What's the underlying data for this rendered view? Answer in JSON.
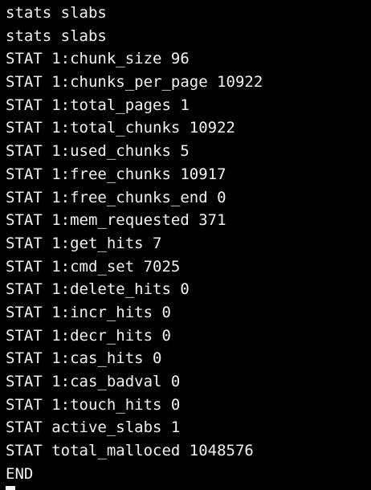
{
  "terminal": {
    "lines": [
      "stats slabs",
      "stats slabs",
      "STAT 1:chunk_size 96",
      "STAT 1:chunks_per_page 10922",
      "STAT 1:total_pages 1",
      "STAT 1:total_chunks 10922",
      "STAT 1:used_chunks 5",
      "STAT 1:free_chunks 10917",
      "STAT 1:free_chunks_end 0",
      "STAT 1:mem_requested 371",
      "STAT 1:get_hits 7",
      "STAT 1:cmd_set 7025",
      "STAT 1:delete_hits 0",
      "STAT 1:incr_hits 0",
      "STAT 1:decr_hits 0",
      "STAT 1:cas_hits 0",
      "STAT 1:cas_badval 0",
      "STAT 1:touch_hits 0",
      "STAT active_slabs 1",
      "STAT total_malloced 1048576",
      "END"
    ]
  }
}
